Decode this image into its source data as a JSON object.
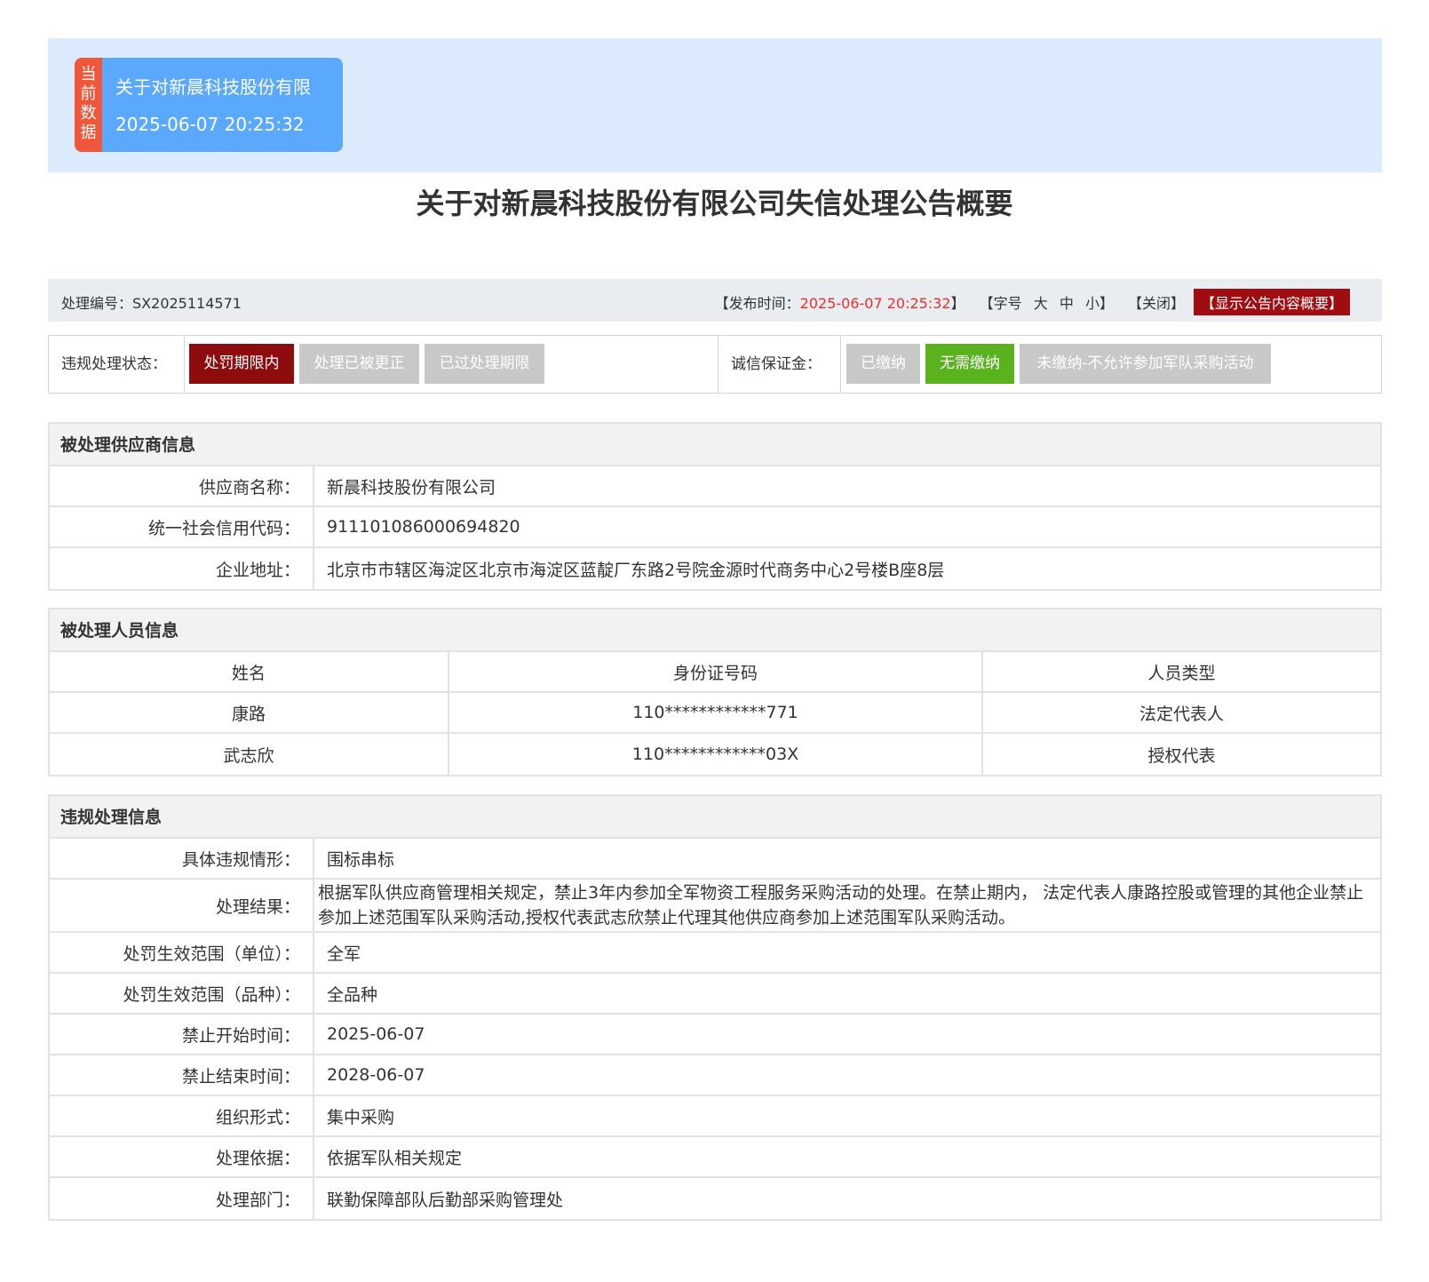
{
  "current_card": {
    "tag": "当前数据",
    "title": "关于对新晨科技股份有限",
    "time": "2025-06-07 20:25:32"
  },
  "page_title": "关于对新晨科技股份有限公司失信处理公告概要",
  "meta": {
    "id_label": "处理编号：",
    "id_value": "SX2025114571",
    "publish_prefix": "【发布时间：",
    "publish_time": "2025-06-07 20:25:32",
    "publish_suffix": "】",
    "font_prefix": "【字号",
    "font_large": "大",
    "font_medium": "中",
    "font_small": "小",
    "font_suffix": "】",
    "close": "【关闭】",
    "show_summary": "【显示公告内容概要】"
  },
  "status": {
    "violation_label": "违规处理状态：",
    "violation_chips": [
      {
        "label": "处罚期限内",
        "state": "active"
      },
      {
        "label": "处理已被更正",
        "state": "inactive"
      },
      {
        "label": "已过处理期限",
        "state": "inactive"
      }
    ],
    "deposit_label": "诚信保证金：",
    "deposit_chips": [
      {
        "label": "已缴纳",
        "state": "inactive"
      },
      {
        "label": "无需缴纳",
        "state": "active"
      },
      {
        "label": "未缴纳-不允许参加军队采购活动",
        "state": "inactive"
      }
    ],
    "colors": {
      "active_red": "#8e0b0e",
      "active_green": "#5ab31e",
      "inactive": "#c8c8c8"
    }
  },
  "supplier": {
    "heading": "被处理供应商信息",
    "rows": [
      {
        "label": "供应商名称：",
        "value": "新晨科技股份有限公司"
      },
      {
        "label": "统一社会信用代码：",
        "value": "911101086000694820"
      },
      {
        "label": "企业地址：",
        "value": "北京市市辖区海淀区北京市海淀区蓝靛厂东路2号院金源时代商务中心2号楼B座8层"
      }
    ]
  },
  "persons": {
    "heading": "被处理人员信息",
    "columns": [
      "姓名",
      "身份证号码",
      "人员类型"
    ],
    "rows": [
      [
        "康路",
        "110************771",
        "法定代表人"
      ],
      [
        "武志欣",
        "110************03X",
        "授权代表"
      ]
    ]
  },
  "violation": {
    "heading": "违规处理信息",
    "rows": [
      {
        "label": "具体违规情形：",
        "value": "围标串标"
      },
      {
        "label": "处理结果：",
        "value": "根据军队供应商管理相关规定，禁止3年内参加全军物资工程服务采购活动的处理。在禁止期内， 法定代表人康路控股或管理的其他企业禁止参加上述范围军队采购活动,授权代表武志欣禁止代理其他供应商参加上述范围军队采购活动。"
      },
      {
        "label": "处罚生效范围（单位）：",
        "value": "全军"
      },
      {
        "label": "处罚生效范围（品种）：",
        "value": "全品种"
      },
      {
        "label": "禁止开始时间：",
        "value": "2025-06-07"
      },
      {
        "label": "禁止结束时间：",
        "value": "2028-06-07"
      },
      {
        "label": "组织形式：",
        "value": "集中采购"
      },
      {
        "label": "处理依据：",
        "value": "依据军队相关规定"
      },
      {
        "label": "处理部门：",
        "value": "联勤保障部队后勤部采购管理处"
      }
    ]
  }
}
